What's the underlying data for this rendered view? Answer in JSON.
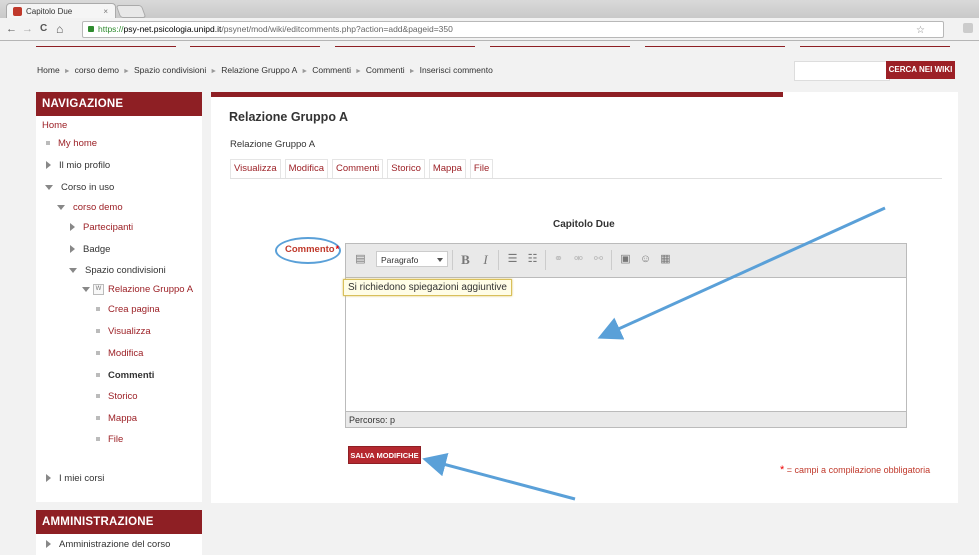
{
  "browser": {
    "tab_title": "Capitolo Due",
    "tab_close": "×",
    "back": "←",
    "forward": "→",
    "reload": "C",
    "home": "⌂",
    "url_scheme": "https://",
    "url_host": "psy-net.psicologia.unipd.it",
    "url_path": "/psynet/mod/wiki/editcomments.php?action=add&pageid=350",
    "star": "☆"
  },
  "breadcrumb": [
    "Home",
    "corso demo",
    "Spazio condivisioni",
    "Relazione Gruppo A",
    "Commenti",
    "Commenti",
    "Inserisci commento"
  ],
  "breadcrumb_sep": "►",
  "search": {
    "button": "CERCA NEI WIKI",
    "placeholder": ""
  },
  "navigation": {
    "title": "NAVIGAZIONE",
    "home": "Home",
    "my_home": "My home",
    "profile": "Il mio profilo",
    "current_course": "Corso in uso",
    "course": "corso demo",
    "participants": "Partecipanti",
    "badge": "Badge",
    "shared_space": "Spazio condivisioni",
    "wiki_icon": "W",
    "wiki": "Relazione Gruppo A",
    "create_page": "Crea pagina",
    "view": "Visualizza",
    "edit": "Modifica",
    "comments": "Commenti",
    "history": "Storico",
    "map": "Mappa",
    "files": "File",
    "my_courses": "I miei corsi"
  },
  "administration": {
    "title": "AMMINISTRAZIONE",
    "course_admin": "Amministrazione del corso"
  },
  "main": {
    "title": "Relazione Gruppo A",
    "subtitle": "Relazione Gruppo A",
    "tabs": [
      "Visualizza",
      "Modifica",
      "Commenti",
      "Storico",
      "Mappa",
      "File"
    ],
    "page_title": "Capitolo Due",
    "field_label": "Commento",
    "required_mark": "*",
    "editor": {
      "format": "Paragrafo",
      "content": "Si richiedono spiegazioni aggiuntive",
      "path": "Percorso: p"
    },
    "save_button": "SALVA MODIFICHE",
    "required_note": "= campi a compilazione obbligatoria"
  },
  "colors": {
    "brand": "#8e1f24",
    "link": "#9c2026",
    "annotation": "#5aa0d8"
  }
}
